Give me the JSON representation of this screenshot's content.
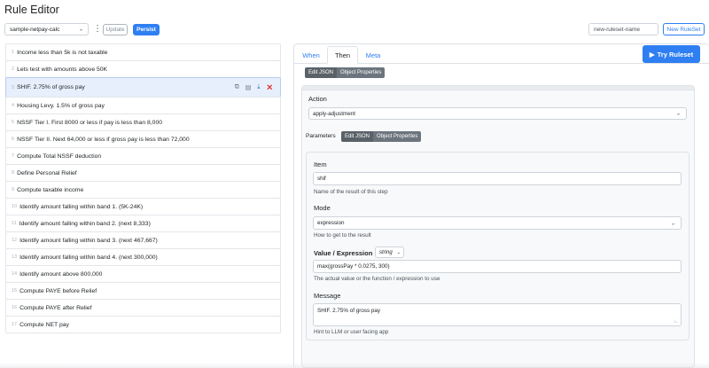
{
  "page": {
    "title": "Rule Editor"
  },
  "toolbar": {
    "ruleset_select_value": "sample-netpay-calc",
    "update_label": "Update",
    "persist_label": "Persist",
    "new_ruleset_name_value": "new-ruleset-name",
    "new_ruleset_label": "New RuleSet"
  },
  "rules": [
    {
      "num": "1",
      "label": "Income less than 5k is not taxable"
    },
    {
      "num": "2",
      "label": "Lets test with amounts above 50K"
    },
    {
      "num": "3",
      "label": "SHIF. 2.75% of gross pay"
    },
    {
      "num": "4",
      "label": "Housing Levy. 1.5% of gross pay"
    },
    {
      "num": "5",
      "label": "NSSF Tier I. First 8000 or less if pay is less than 8,000"
    },
    {
      "num": "6",
      "label": "NSSF Tier II. Next 64,000 or less if gross pay is less than 72,000"
    },
    {
      "num": "7",
      "label": "Compute Total NSSF deduction"
    },
    {
      "num": "8",
      "label": "Define Personal Relief"
    },
    {
      "num": "9",
      "label": "Compute taxable income"
    },
    {
      "num": "10",
      "label": "Identify amount falling within band 1. (5K-24K)"
    },
    {
      "num": "11",
      "label": "Identify amount falling within band 2. (next 8,333)"
    },
    {
      "num": "12",
      "label": "Identify amount falling within band 3. (next 467,667)"
    },
    {
      "num": "13",
      "label": "Identify amount falling within band 4. (next 300,000)"
    },
    {
      "num": "14",
      "label": "Identify amount above 800,000"
    },
    {
      "num": "15",
      "label": "Compute PAYE before Relief"
    },
    {
      "num": "16",
      "label": "Compute PAYE after Relief"
    },
    {
      "num": "17",
      "label": "Compute NET pay"
    }
  ],
  "rule_actions": {
    "copy_icon": "copy-icon",
    "save_icon": "save-icon",
    "move_icon": "move-down-icon",
    "delete_icon": "delete-icon"
  },
  "tabs": [
    {
      "label": "When"
    },
    {
      "label": "Then"
    },
    {
      "label": "Meta"
    }
  ],
  "try_ruleset_label": "Try Ruleset",
  "then_panel": {
    "edit_json_label": "Edit JSON",
    "object_properties_label": "Object Properties",
    "action_label": "Action",
    "action_value": "apply-adjustment",
    "parameters_label": "Parameters",
    "params_edit_json_label": "Edit JSON",
    "params_object_properties_label": "Object Properties",
    "item_label": "Item",
    "item_value": "shif",
    "item_help": "Name of the result of this step",
    "mode_label": "Mode",
    "mode_value": "expression",
    "mode_help": "How to get to the result",
    "value_label": "Value / Expression",
    "value_type": "string",
    "value_value": "max(grossPay * 0.0275, 300)",
    "value_help": "The actual value or the function / expression to use",
    "message_label": "Message",
    "message_value": "SHIF. 2.75% of gross pay",
    "message_help": "Hint to LLM or user facing app"
  }
}
